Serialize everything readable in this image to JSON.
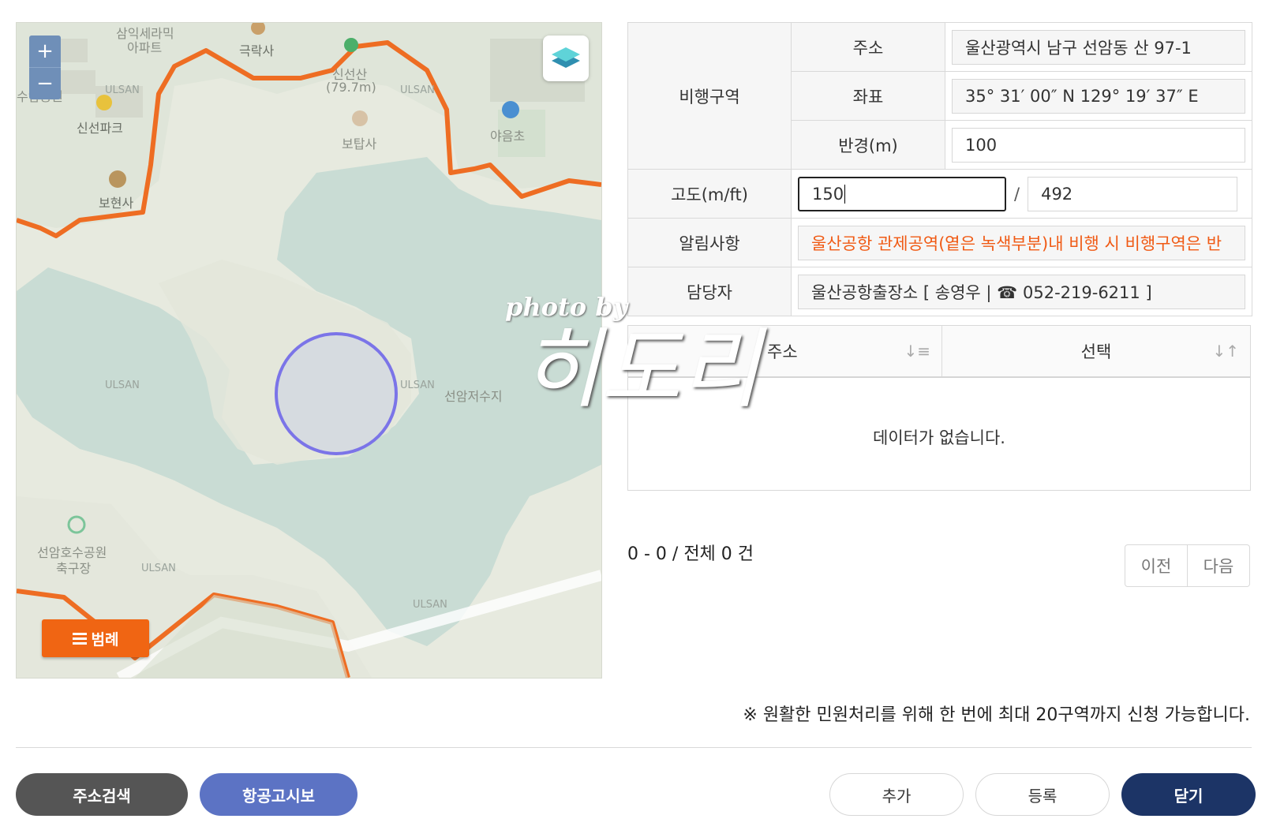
{
  "map": {
    "zoom_in": "+",
    "zoom_out": "−",
    "legend_label": "범례",
    "labels": {
      "apt": "삼익세라믹",
      "apt2": "아파트",
      "temple1": "극락사",
      "mountain": "신선산",
      "mountain_h": "(79.7m)",
      "temple2": "보탑사",
      "park1": "신선파크",
      "park_left": "수암공원",
      "school": "야음초",
      "temple3": "보현사",
      "lake": "선암저수지",
      "lakepark": "선암호수공원",
      "field": "축구장",
      "region_tag": "ULSAN",
      "region_tag2": "ULSAN",
      "region_tag3": "ULSAN",
      "region_tag4": "ULSAN",
      "region_tag5": "ULSAN",
      "region_tag6": "ULSAN"
    },
    "colors": {
      "boundary": "#ee6d23",
      "lake": "#c9dcd4",
      "land": "#e7eadf",
      "radius": "#7b74e8"
    }
  },
  "form": {
    "flight_zone_label": "비행구역",
    "address_label": "주소",
    "address_value": "울산광역시 남구 선암동 산 97-1",
    "coord_label": "좌표",
    "coord_value": "35° 31′ 00″ N 129° 19′ 37″ E",
    "radius_label": "반경(m)",
    "radius_value": "100",
    "altitude_label": "고도(m/ft)",
    "altitude_m": "150",
    "altitude_sep": "/",
    "altitude_ft": "492",
    "notice_label": "알림사항",
    "notice_value": "울산공항 관제공역(옅은 녹색부분)내 비행 시 비행구역은 반",
    "manager_label": "담당자",
    "manager_value": "울산공항출장소 [ 송영우 | ☎ 052-219-6211 ]"
  },
  "result": {
    "col_address": "주소",
    "col_select": "선택",
    "empty": "데이터가 없습니다.",
    "count": "0 - 0 / 전체 0 건",
    "prev": "이전",
    "next": "다음"
  },
  "notice": "※ 원활한 민원처리를 위해 한 번에 최대 20구역까지 신청 가능합니다.",
  "buttons": {
    "address_search": "주소검색",
    "aip": "항공고시보",
    "add": "추가",
    "register": "등록",
    "close": "닫기"
  },
  "watermark": {
    "line1": "photo by",
    "line2": "히도리"
  }
}
